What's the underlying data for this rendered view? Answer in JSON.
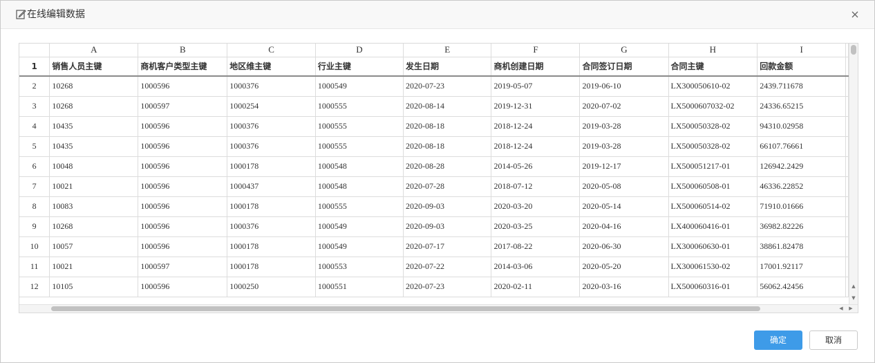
{
  "dialog": {
    "title": "在线编辑数据",
    "title_icon": "edit-icon",
    "close_icon": "close-icon"
  },
  "sheet": {
    "column_letters": [
      "A",
      "B",
      "C",
      "D",
      "E",
      "F",
      "G",
      "H",
      "I"
    ],
    "field_row_number": "1",
    "fields": [
      "销售人员主键",
      "商机客户类型主键",
      "地区维主键",
      "行业主键",
      "发生日期",
      "商机创建日期",
      "合同签订日期",
      "合同主键",
      "回款金额"
    ],
    "rows": [
      {
        "n": "2",
        "cells": [
          "10268",
          "1000596",
          "1000376",
          "1000549",
          "2020-07-23",
          "2019-05-07",
          "2019-06-10",
          "LX300050610-02",
          "2439.711678"
        ]
      },
      {
        "n": "3",
        "cells": [
          "10268",
          "1000597",
          "1000254",
          "1000555",
          "2020-08-14",
          "2019-12-31",
          "2020-07-02",
          "LX5000607032-02",
          "24336.65215"
        ]
      },
      {
        "n": "4",
        "cells": [
          "10435",
          "1000596",
          "1000376",
          "1000555",
          "2020-08-18",
          "2018-12-24",
          "2019-03-28",
          "LX500050328-02",
          "94310.02958"
        ]
      },
      {
        "n": "5",
        "cells": [
          "10435",
          "1000596",
          "1000376",
          "1000555",
          "2020-08-18",
          "2018-12-24",
          "2019-03-28",
          "LX500050328-02",
          "66107.76661"
        ]
      },
      {
        "n": "6",
        "cells": [
          "10048",
          "1000596",
          "1000178",
          "1000548",
          "2020-08-28",
          "2014-05-26",
          "2019-12-17",
          "LX500051217-01",
          "126942.2429"
        ]
      },
      {
        "n": "7",
        "cells": [
          "10021",
          "1000596",
          "1000437",
          "1000548",
          "2020-07-28",
          "2018-07-12",
          "2020-05-08",
          "LX500060508-01",
          "46336.22852"
        ]
      },
      {
        "n": "8",
        "cells": [
          "10083",
          "1000596",
          "1000178",
          "1000555",
          "2020-09-03",
          "2020-03-20",
          "2020-05-14",
          "LX500060514-02",
          "71910.01666"
        ]
      },
      {
        "n": "9",
        "cells": [
          "10268",
          "1000596",
          "1000376",
          "1000549",
          "2020-09-03",
          "2020-03-25",
          "2020-04-16",
          "LX400060416-01",
          "36982.82226"
        ]
      },
      {
        "n": "10",
        "cells": [
          "10057",
          "1000596",
          "1000178",
          "1000549",
          "2020-07-17",
          "2017-08-22",
          "2020-06-30",
          "LX300060630-01",
          "38861.82478"
        ]
      },
      {
        "n": "11",
        "cells": [
          "10021",
          "1000597",
          "1000178",
          "1000553",
          "2020-07-22",
          "2014-03-06",
          "2020-05-20",
          "LX300061530-02",
          "17001.92117"
        ]
      },
      {
        "n": "12",
        "cells": [
          "10105",
          "1000596",
          "1000250",
          "1000551",
          "2020-07-23",
          "2020-02-11",
          "2020-03-16",
          "LX500060316-01",
          "56062.42456"
        ]
      }
    ]
  },
  "footer": {
    "ok_label": "确定",
    "cancel_label": "取消"
  },
  "colors": {
    "primary": "#3e9be8",
    "header_bg": "#f8f8f8",
    "grid_line": "#dcdcdc"
  }
}
